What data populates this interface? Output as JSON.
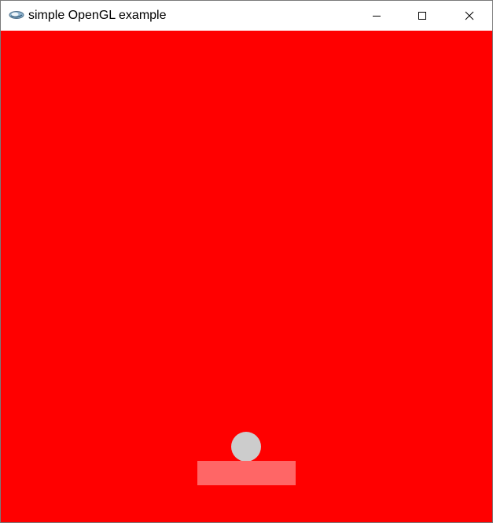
{
  "window": {
    "title": "simple OpenGL example",
    "app_icon": "opengl-app-icon",
    "controls": {
      "minimize_icon": "minimize-icon",
      "maximize_icon": "maximize-icon",
      "close_icon": "close-icon"
    }
  },
  "scene": {
    "background_color": "#ff0000",
    "ball": {
      "color": "#cccccc",
      "shape": "circle"
    },
    "paddle": {
      "color": "#ff6666",
      "shape": "rectangle"
    }
  }
}
